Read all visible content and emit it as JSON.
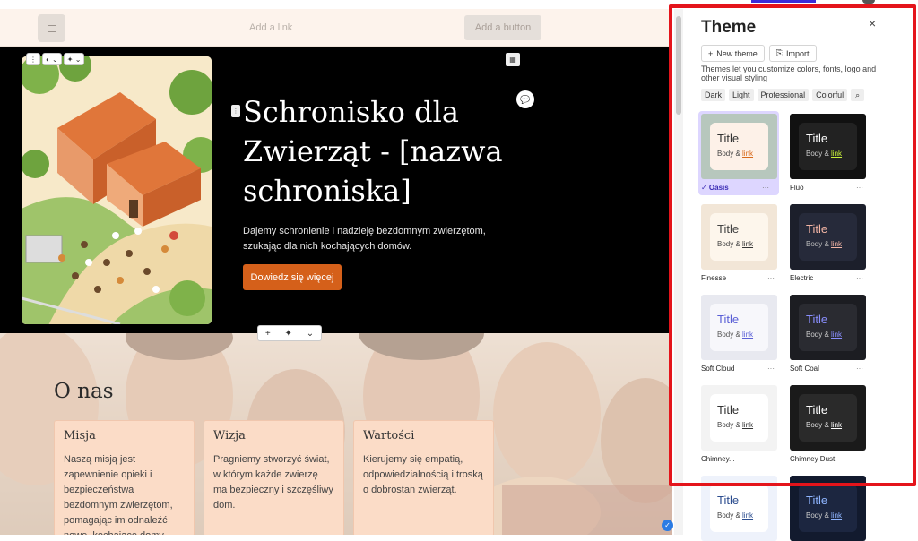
{
  "topbar": {
    "add_link": "Add a link",
    "add_button": "Add a button"
  },
  "hero": {
    "title": "Schronisko dla Zwierząt - [nazwa schroniska]",
    "subtitle": "Dajemy schronienie i nadzieję bezdomnym zwierzętom, szukając dla nich kochających domów.",
    "cta": "Dowiedz się więcej",
    "toolbar": [
      "⋮",
      "◐ ⌄",
      "✦ ⌄"
    ]
  },
  "insert_bar": {
    "plus": "+",
    "ai": "✦",
    "more": "⌄"
  },
  "about": {
    "title": "O nas",
    "cards": [
      {
        "heading": "Misja",
        "body": "Naszą misją jest zapewnienie opieki i bezpieczeństwa bezdomnym zwierzętom, pomagając im odnaleźć nowe, kochające domy."
      },
      {
        "heading": "Wizja",
        "body": "Pragniemy stworzyć świat, w którym każde zwierzę ma bezpieczny i szczęśliwy dom."
      },
      {
        "heading": "Wartości",
        "body": "Kierujemy się empatią, odpowiedzialnością i troską o dobrostan zwierząt."
      }
    ]
  },
  "panel": {
    "title": "Theme",
    "close": "×",
    "new_theme": "New theme",
    "import": "Import",
    "description": "Themes let you customize colors, fonts, logo and other visual styling",
    "filters": [
      "Dark",
      "Light",
      "Professional",
      "Colorful"
    ],
    "sample_title": "Title",
    "sample_body": "Body &",
    "sample_link": "link",
    "more": "···",
    "themes": [
      {
        "name": "Oasis",
        "selected": true,
        "outer": "#b7c7bd",
        "inner": "#fdf1e8",
        "title": "#333333",
        "body": "#444444",
        "link": "#d86a1b"
      },
      {
        "name": "Fluo",
        "outer": "#111111",
        "inner": "#222222",
        "title": "#ffffff",
        "body": "#cccccc",
        "link": "#c8f03a"
      },
      {
        "name": "Finesse",
        "outer": "#f2e6d7",
        "inner": "#fdf6ec",
        "title": "#444444",
        "body": "#444444",
        "link": "#333333"
      },
      {
        "name": "Electric",
        "outer": "#1c1f2b",
        "inner": "#262a3a",
        "title": "#f3b5a5",
        "body": "#bbbbbb",
        "link": "#f3b5a5"
      },
      {
        "name": "Soft Cloud",
        "outer": "#e8e9f0",
        "inner": "#f7f7fb",
        "title": "#5a5fd6",
        "body": "#555555",
        "link": "#5a5fd6"
      },
      {
        "name": "Soft Coal",
        "outer": "#1c1d22",
        "inner": "#2a2b31",
        "title": "#8a8fff",
        "body": "#cccccc",
        "link": "#8a8fff"
      },
      {
        "name": "Chimney...",
        "outer": "#f3f3f3",
        "inner": "#ffffff",
        "title": "#333333",
        "body": "#444444",
        "link": "#333333"
      },
      {
        "name": "Chimney Dust",
        "outer": "#1a1a1a",
        "inner": "#2a2a2a",
        "title": "#ffffff",
        "body": "#dddddd",
        "link": "#ffffff"
      },
      {
        "name": "",
        "outer": "#eef2fb",
        "inner": "#ffffff",
        "title": "#2c4d8f",
        "body": "#444444",
        "link": "#2c4d8f"
      },
      {
        "name": "",
        "outer": "#121a2e",
        "inner": "#1c2640",
        "title": "#8fb5ff",
        "body": "#cccccc",
        "link": "#8fb5ff"
      }
    ]
  },
  "colors": {
    "accent": "#d5601a",
    "highlight": "#e4141b",
    "selected": "#ddd6ff",
    "check": "#2a7be4"
  }
}
